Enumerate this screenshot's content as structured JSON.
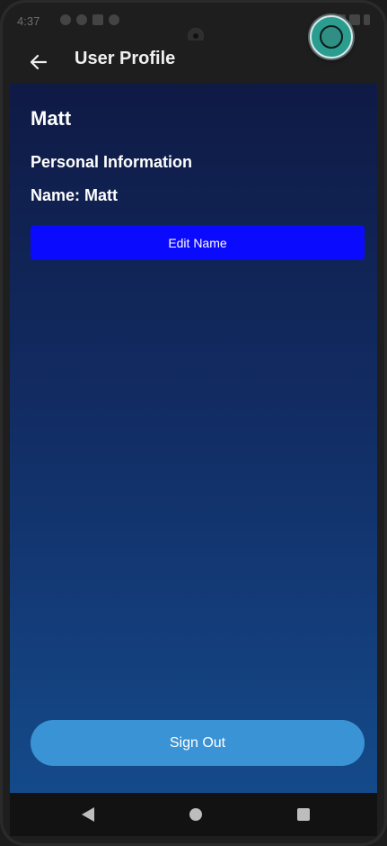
{
  "status_bar": {
    "time": "4:37"
  },
  "app_bar": {
    "title": "User Profile"
  },
  "profile": {
    "heading": "Matt",
    "section_title": "Personal Information",
    "name_line": "Name: Matt"
  },
  "actions": {
    "edit_label": "Edit Name",
    "signout_label": "Sign Out"
  },
  "icons": {
    "back": "arrow-left-icon",
    "fab": "overlay-bubble-icon",
    "nav_back": "triangle-back-icon",
    "nav_home": "circle-home-icon",
    "nav_recent": "square-recents-icon"
  },
  "colors": {
    "edit_button": "#0a0aff",
    "signout_button": "#3a93d4",
    "gradient_top": "#0f1a45",
    "gradient_bottom": "#144a8a"
  }
}
